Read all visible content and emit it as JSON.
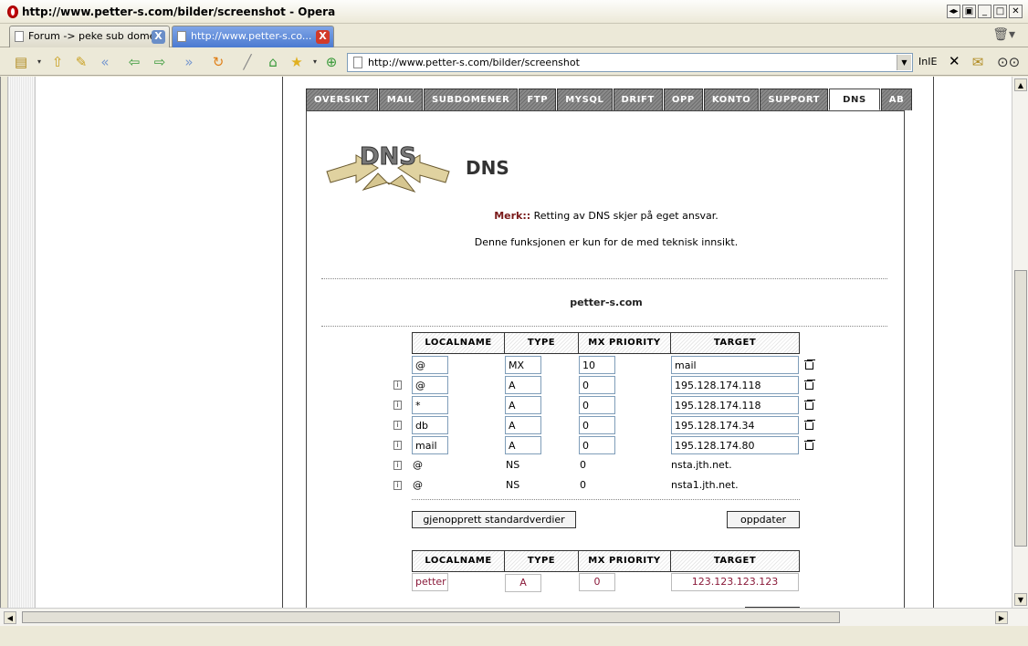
{
  "window": {
    "title": "http://www.petter-s.com/bilder/screenshot - Opera"
  },
  "tabs": [
    {
      "label": "Forum -> peke sub dome...",
      "close": "X"
    },
    {
      "label": "http://www.petter-s.co...",
      "close": "X"
    }
  ],
  "toolbar": {
    "address": "http://www.petter-s.com/bilder/screenshot",
    "inie": "InIE",
    "close": "✕"
  },
  "nav": [
    "OVERSIKT",
    "MAIL",
    "SUBDOMENER",
    "FTP",
    "MYSQL",
    "DRIFT",
    "OPP",
    "KONTO",
    "SUPPORT",
    "DNS",
    "AB"
  ],
  "page": {
    "logo_text": "DNS",
    "heading": "DNS",
    "merk_label": "Merk::",
    "merk_text": " Retting av DNS skjer på eget ansvar.",
    "info_text": "Denne funksjonen er kun for de med teknisk innsikt.",
    "domain": "petter-s.com"
  },
  "table": {
    "headers": [
      "LOCALNAME",
      "TYPE",
      "MX PRIORITY",
      "TARGET"
    ],
    "rows": [
      {
        "localname": "@",
        "type": "MX",
        "priority": "10",
        "target": "mail"
      },
      {
        "localname": "@",
        "type": "A",
        "priority": "0",
        "target": "195.128.174.118"
      },
      {
        "localname": "*",
        "type": "A",
        "priority": "0",
        "target": "195.128.174.118"
      },
      {
        "localname": "db",
        "type": "A",
        "priority": "0",
        "target": "195.128.174.34"
      },
      {
        "localname": "mail",
        "type": "A",
        "priority": "0",
        "target": "195.128.174.80"
      }
    ],
    "static_rows": [
      {
        "localname": "@",
        "type": "NS",
        "priority": "0",
        "target": "nsta.jth.net."
      },
      {
        "localname": "@",
        "type": "NS",
        "priority": "0",
        "target": "nsta1.jth.net."
      }
    ],
    "restore_button": "gjenopprett standardverdier",
    "update_button": "oppdater"
  },
  "new_record": {
    "headers": [
      "LOCALNAME",
      "TYPE",
      "MX PRIORITY",
      "TARGET"
    ],
    "localname": "petter",
    "type": "A",
    "priority": "0",
    "target": "123.123.123.123"
  }
}
